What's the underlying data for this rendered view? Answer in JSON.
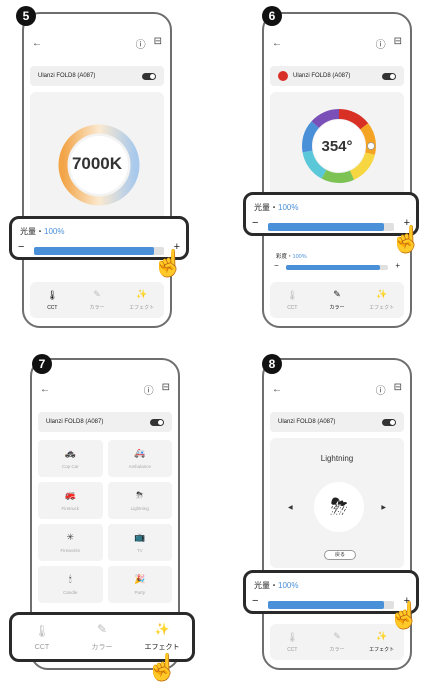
{
  "steps": [
    "5",
    "6",
    "7",
    "8"
  ],
  "common": {
    "device_name": "Ulanzi FOLD8 (A087)",
    "back_icon": "←",
    "info_icon": "ⓘ",
    "menu_icon": "⊟",
    "brightness_label": "光量・",
    "brightness_value": "100%",
    "minus": "−",
    "plus": "+",
    "brightness_fraction": 0.92,
    "tabs": [
      "CCT",
      "カラー",
      "エフェクト"
    ]
  },
  "screen5": {
    "cct_value": "7000K"
  },
  "screen6": {
    "hue_value": "354°",
    "saturation_label": "彩度・",
    "saturation_value": "100%",
    "saturation_fraction": 0.92,
    "swatches": [
      "#d93025",
      "#f4a422",
      "#f6d742",
      "#7cc353",
      "#5ac8d8",
      "#4a90d9",
      "#7b4fb8"
    ]
  },
  "screen7": {
    "effects": [
      {
        "label": "Cop Car",
        "icon": "police-icon",
        "glyph": "🚓"
      },
      {
        "label": "Ambulance",
        "icon": "ambulance-icon",
        "glyph": "🚑"
      },
      {
        "label": "Firetruck",
        "icon": "firetruck-icon",
        "glyph": "🚒"
      },
      {
        "label": "Lightning",
        "icon": "lightning-icon",
        "glyph": "⛈"
      },
      {
        "label": "Fireworks",
        "icon": "fireworks-icon",
        "glyph": "✳"
      },
      {
        "label": "TV",
        "icon": "tv-icon",
        "glyph": "📺"
      },
      {
        "label": "Candle",
        "icon": "candle-icon",
        "glyph": "🕯"
      },
      {
        "label": "Party",
        "icon": "party-icon",
        "glyph": "🎉"
      }
    ]
  },
  "screen8": {
    "effect_name": "Lightning",
    "back_button": "戻る",
    "prev_arrow": "◀",
    "next_arrow": "▶"
  }
}
